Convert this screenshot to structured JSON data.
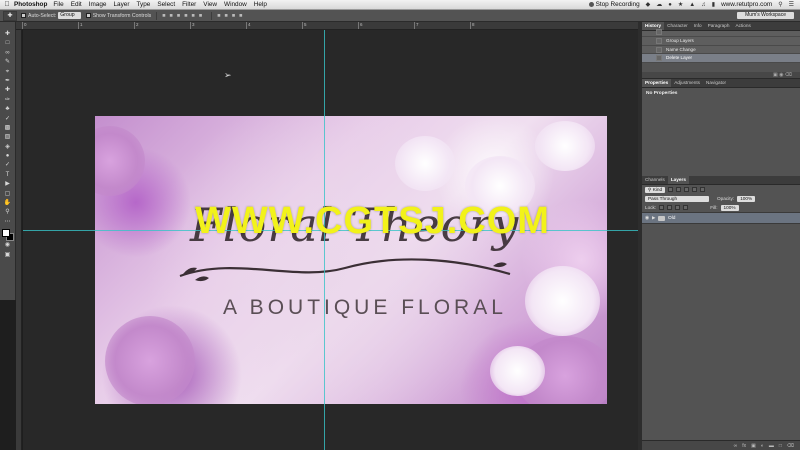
{
  "menubar": {
    "app_name": "Photoshop",
    "items": [
      "File",
      "Edit",
      "Image",
      "Layer",
      "Type",
      "Select",
      "Filter",
      "View",
      "Window",
      "Help"
    ],
    "stop_recording": "Stop Recording",
    "site": "www.retutpro.com"
  },
  "options_bar": {
    "auto_select_label": "Auto-Select:",
    "auto_select_value": "Group",
    "show_transform_label": "Show Transform Controls",
    "workspace": "Mum's Workspace"
  },
  "ruler": {
    "labels": [
      "0",
      "1",
      "2",
      "3",
      "4",
      "5",
      "6",
      "7",
      "8"
    ]
  },
  "canvas": {
    "title_script": "Floral Theory",
    "subtitle": "A BOUTIQUE FLORAL",
    "watermark": "WWW.CGTSJ.COM"
  },
  "history_panel": {
    "tabs": [
      "History",
      "Character",
      "Info",
      "Paragraph",
      "Actions"
    ],
    "items": [
      {
        "label": "Group Layers"
      },
      {
        "label": "Name Change"
      },
      {
        "label": "Delete Layer"
      }
    ]
  },
  "properties_panel": {
    "tabs": [
      "Properties",
      "Adjustments",
      "Navigator"
    ],
    "body": "No Properties"
  },
  "layers_panel": {
    "tabs": [
      "Channels",
      "Layers"
    ],
    "kind_label": "Kind",
    "blend_mode": "Pass Through",
    "opacity_label": "Opacity:",
    "opacity_value": "100%",
    "lock_label": "Lock:",
    "fill_label": "Fill:",
    "fill_value": "100%",
    "layer_name": "Old"
  },
  "colors": {
    "accent_guide": "#37c3c7",
    "watermark": "#f2f21a",
    "panel_bg": "#535353",
    "selected_row": "#6b7481"
  }
}
